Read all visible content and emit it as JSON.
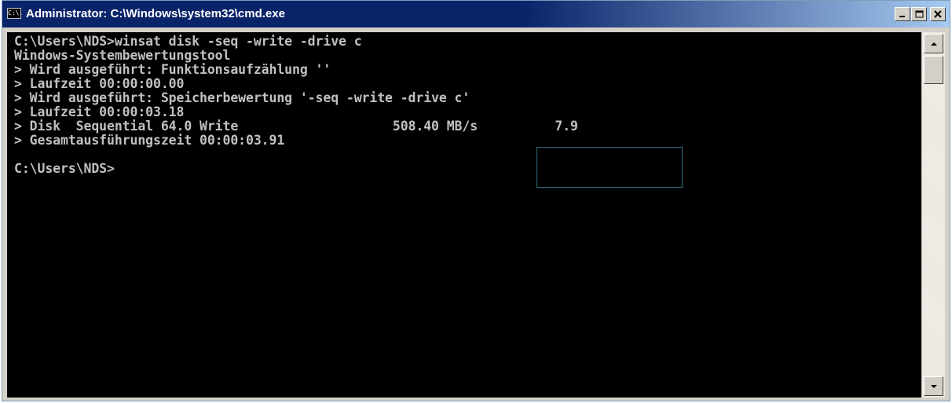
{
  "window": {
    "title": "Administrator: C:\\Windows\\system32\\cmd.exe",
    "icon_label": "C:\\.",
    "buttons": [
      "minimize-icon",
      "maximize-icon",
      "close-icon"
    ]
  },
  "console": {
    "lines": [
      "C:\\Users\\NDS>winsat disk -seq -write -drive c",
      "Windows-Systembewertungstool",
      "> Wird ausgeführt: Funktionsaufzählung ''",
      "> Laufzeit 00:00:00.00",
      "> Wird ausgeführt: Speicherbewertung '-seq -write -drive c'",
      "> Laufzeit 00:00:03.18",
      "> Disk  Sequential 64.0 Write                    508.40 MB/s          7.9",
      "> Gesamtausführungszeit 00:00:03.91",
      "",
      "C:\\Users\\NDS>"
    ]
  },
  "colors": {
    "title_bar": "#0a246a",
    "console_bg": "#000000",
    "console_text": "#c0c0c0",
    "highlight_border": "#2f6f7a"
  }
}
